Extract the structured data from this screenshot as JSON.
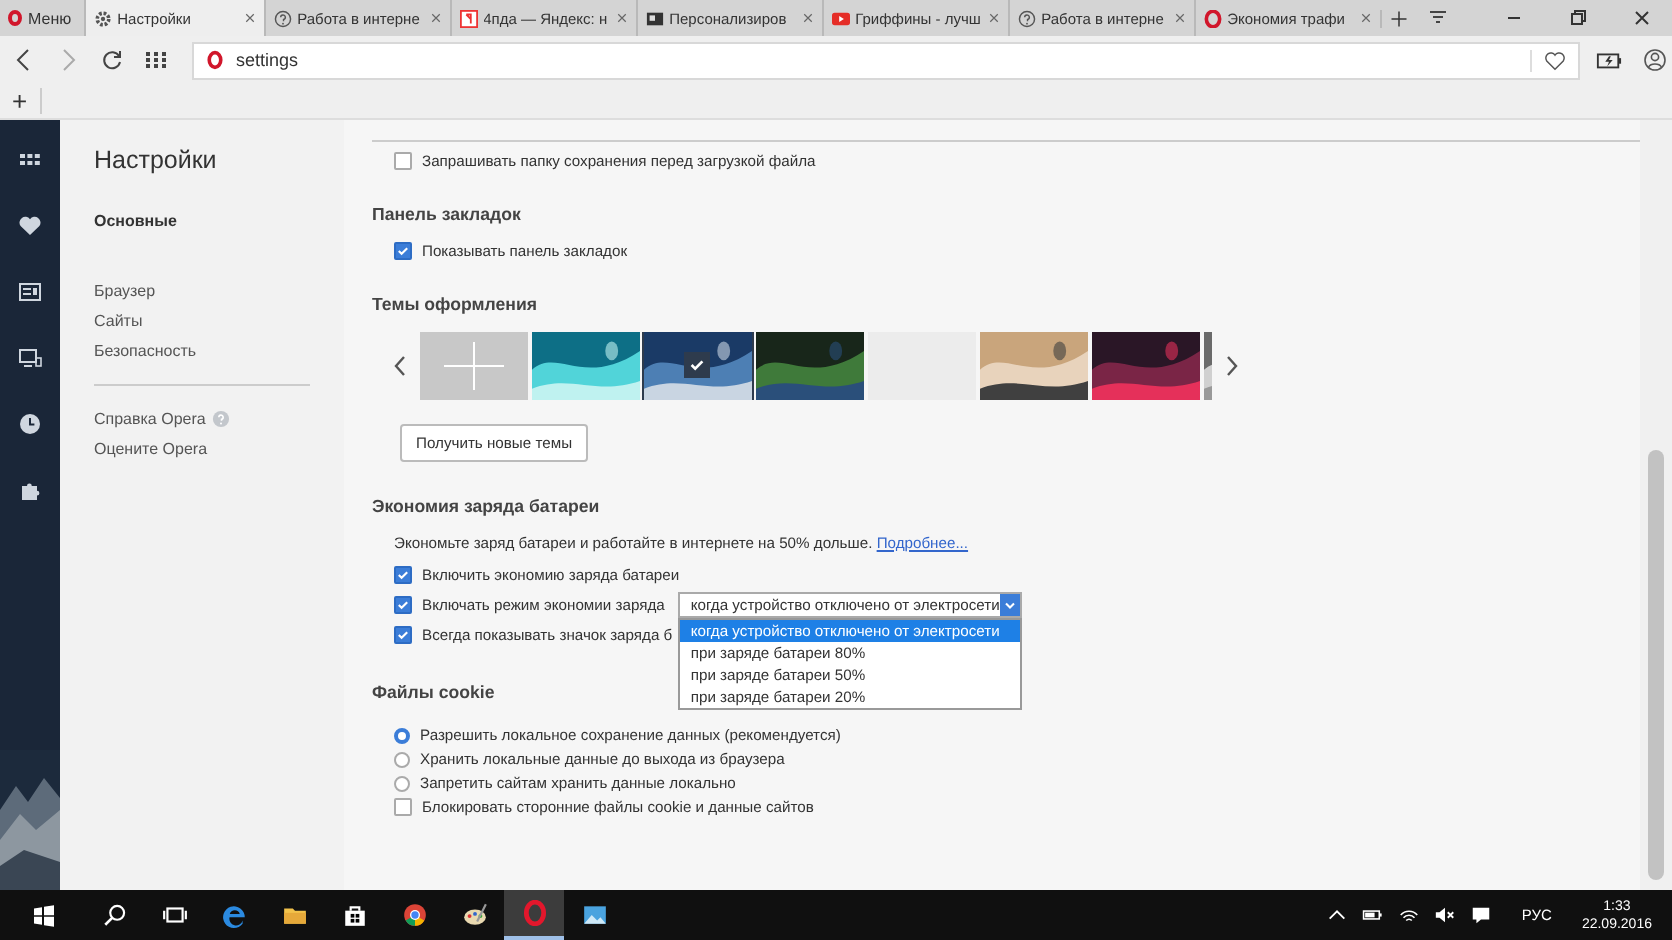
{
  "menu_button": {
    "label": "Меню"
  },
  "tabs": [
    {
      "label": "Настройки",
      "kind": "gear",
      "selected": true
    },
    {
      "label": "Работа в интерне",
      "kind": "help",
      "selected": false
    },
    {
      "label": "4пда — Яндекс: н",
      "kind": "yandex",
      "selected": false
    },
    {
      "label": "Персонализиров",
      "kind": "news",
      "selected": false
    },
    {
      "label": "Гриффины - лучш",
      "kind": "video",
      "selected": false
    },
    {
      "label": "Работа в интерне",
      "kind": "help",
      "selected": false
    },
    {
      "label": "Экономия трафи",
      "kind": "opera",
      "selected": false
    }
  ],
  "address_bar": {
    "value": "settings"
  },
  "bookmarks_bar": {
    "add_label": "+"
  },
  "settings_nav": {
    "title": "Настройки",
    "groups": [
      [
        {
          "label": "Основные",
          "selected": true
        }
      ],
      [
        {
          "label": "Браузер",
          "selected": false
        },
        {
          "label": "Сайты",
          "selected": false
        },
        {
          "label": "Безопасность",
          "selected": false
        }
      ]
    ],
    "links": [
      {
        "label": "Справка Opera",
        "help": true
      },
      {
        "label": "Оцените Opera",
        "help": false
      }
    ]
  },
  "downloads": {
    "ask_folder": {
      "label": "Запрашивать папку сохранения перед загрузкой файла",
      "checked": false
    }
  },
  "bookmarks": {
    "title": "Панель закладок",
    "show": {
      "label": "Показывать панель закладок",
      "checked": true
    }
  },
  "themes": {
    "title": "Темы оформления",
    "items": [
      {
        "kind": "add",
        "selected": false
      },
      {
        "kind": "picture",
        "selected": false
      },
      {
        "kind": "picture",
        "selected": true
      },
      {
        "kind": "picture",
        "selected": false
      },
      {
        "kind": "blank",
        "selected": false
      },
      {
        "kind": "picture",
        "selected": false
      },
      {
        "kind": "picture",
        "selected": false
      },
      {
        "kind": "picture",
        "selected": false
      }
    ],
    "get_button": "Получить новые темы"
  },
  "battery": {
    "title": "Экономия заряда батареи",
    "description": "Экономьте заряд батареи и работайте в интернете на 50% дольше.",
    "link": "Подробнее...",
    "options": [
      {
        "kind": "checkbox",
        "label": "Включить экономию заряда батареи",
        "checked": true
      },
      {
        "kind": "select",
        "label": "Включать режим экономии заряда",
        "checked": true,
        "value": "когда устройство отключено от электросети",
        "expanded": true,
        "choices": [
          {
            "label": "когда устройство отключено от электросети",
            "selected": true
          },
          {
            "label": "при заряде батареи 80%",
            "selected": false
          },
          {
            "label": "при заряде батареи 50%",
            "selected": false
          },
          {
            "label": "при заряде батареи 20%",
            "selected": false
          }
        ]
      },
      {
        "kind": "checkbox",
        "label": "Всегда показывать значок заряда б",
        "checked": true
      }
    ]
  },
  "cookies": {
    "title": "Файлы cookie",
    "options": [
      {
        "kind": "radio",
        "label": "Разрешить локальное сохранение данных (рекомендуется)",
        "selected": true
      },
      {
        "kind": "radio",
        "label": "Хранить локальные данные до выхода из браузера",
        "selected": false
      },
      {
        "kind": "radio",
        "label": "Запретить сайтам хранить данные локально",
        "selected": false
      },
      {
        "kind": "checkbox",
        "label": "Блокировать сторонние файлы cookie и данные сайтов",
        "checked": false
      }
    ]
  },
  "taskbar": {
    "apps": [
      {
        "kind": "search",
        "active": false
      },
      {
        "kind": "taskview",
        "active": false
      },
      {
        "kind": "edge",
        "active": false
      },
      {
        "kind": "folder",
        "active": false
      },
      {
        "kind": "store",
        "active": false
      },
      {
        "kind": "chrome",
        "active": false
      },
      {
        "kind": "paint",
        "active": false
      },
      {
        "kind": "opera",
        "active": true
      },
      {
        "kind": "photos",
        "active": false
      }
    ],
    "language": "РУС",
    "time": "1:33",
    "date": "22.09.2016"
  }
}
